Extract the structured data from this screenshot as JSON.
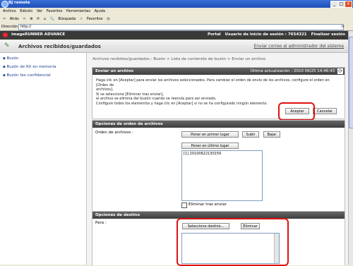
{
  "window": {
    "title": "BJ remote"
  },
  "menu": [
    "Archivo",
    "Edición",
    "Ver",
    "Favoritos",
    "Herramientas",
    "Ayuda"
  ],
  "toolbar": {
    "back": "Atrás",
    "search": "Búsqueda",
    "favorites": "Favoritos"
  },
  "address": {
    "label": "Dirección",
    "value": "http://",
    "go": "Ir"
  },
  "app": {
    "brand": "imageRUNNER ADVANCE",
    "portal": "Portal",
    "user": "Usuario de inicio de sesión : 7654321",
    "logout": "Finalizar sesión",
    "page_title": "Archivos recibidos/guardados",
    "admin_mail": "Enviar correo al administrador del sistema"
  },
  "sidebar": {
    "items": [
      "Buzón",
      "Buzón de RX en memoria",
      "Buzón fax confidencial"
    ]
  },
  "breadcrumb": "Archivos recibidos/guardados : Buzón > Lista de contenido de buzón > Enviar un archivo",
  "send_panel": {
    "title": "Enviar un archivo",
    "updated": "Última actualización : 2010 06/25 14:46:43",
    "lines": [
      "Haga clic en [Aceptar] para enviar los archivos seleccionados. Para cambiar el orden de envío de los archivos, configure el orden en [Orden de",
      "archivos].",
      "Si se selecciona [Eliminar tras enviar],",
      "el archivo se elimina del buzón cuando se reenvía para ser enviado.",
      "Configure todos los elementos y haga clic en [Aceptar] si no se ha configurado ningún elemento."
    ],
    "ok": "Aceptar",
    "cancel": "Cancelar"
  },
  "order_panel": {
    "title": "Opciones de orden de archivos",
    "label": "Orden de archivos :",
    "first": "Poner en primer lugar",
    "up": "Subir",
    "down": "Bajar",
    "last": "Poner en último lugar",
    "files": [
      "[1] 20100622130159"
    ],
    "delete_after": "Eliminar tras enviar"
  },
  "dest_panel": {
    "title": "Opciones de destino",
    "label": "Para :",
    "select": "Seleccione destino...",
    "remove": "Eliminar"
  }
}
